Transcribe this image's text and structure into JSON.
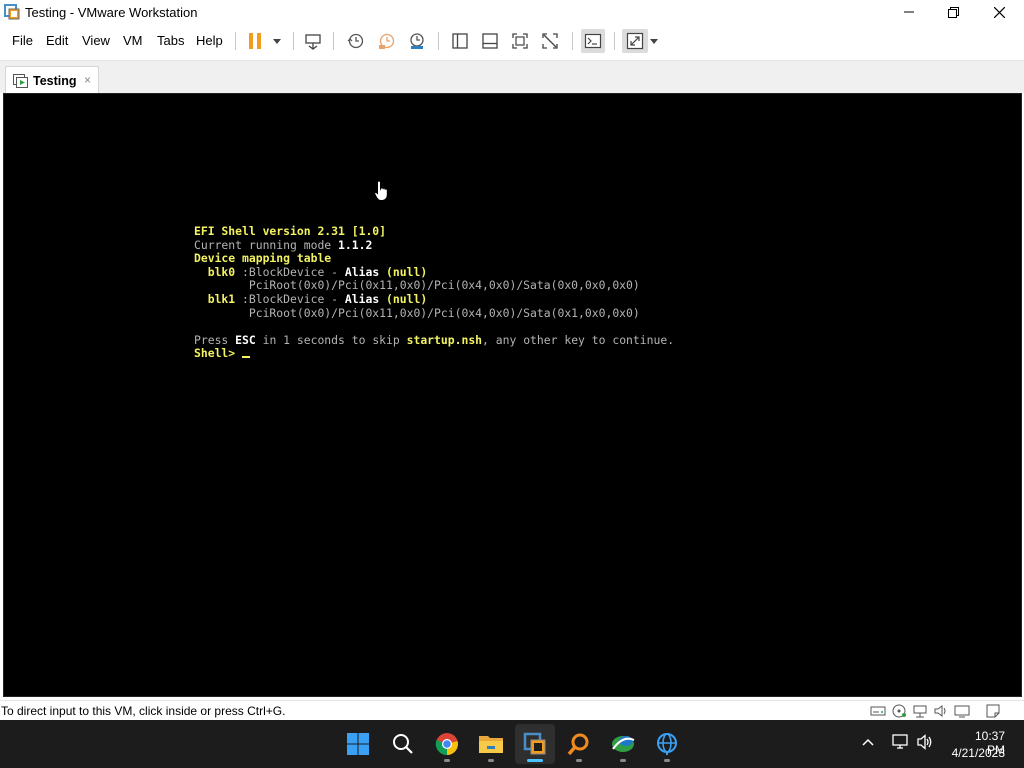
{
  "window": {
    "title": "Testing - VMware Workstation"
  },
  "menu": {
    "items": [
      "File",
      "Edit",
      "View",
      "VM",
      "Tabs",
      "Help"
    ]
  },
  "tab": {
    "label": "Testing",
    "close": "×"
  },
  "console": {
    "lines": [
      [
        {
          "t": "EFI Shell version 2.31 [1.0]",
          "c": "y"
        }
      ],
      [
        {
          "t": "Current running mode ",
          "c": "g"
        },
        {
          "t": "1.1.2",
          "c": "w"
        }
      ],
      [
        {
          "t": "Device mapping table",
          "c": "y"
        }
      ],
      [
        {
          "t": "  blk0",
          "c": "y"
        },
        {
          "t": " :BlockDevice - ",
          "c": "g"
        },
        {
          "t": "Alias",
          "c": "w"
        },
        {
          "t": " (null)",
          "c": "y"
        }
      ],
      [
        {
          "t": "        PciRoot(0x0)/Pci(0x11,0x0)/Pci(0x4,0x0)/Sata(0x0,0x0,0x0)",
          "c": "g"
        }
      ],
      [
        {
          "t": "  blk1",
          "c": "y"
        },
        {
          "t": " :BlockDevice - ",
          "c": "g"
        },
        {
          "t": "Alias",
          "c": "w"
        },
        {
          "t": " (null)",
          "c": "y"
        }
      ],
      [
        {
          "t": "        PciRoot(0x0)/Pci(0x11,0x0)/Pci(0x4,0x0)/Sata(0x1,0x0,0x0)",
          "c": "g"
        }
      ],
      [
        {
          "t": "",
          "c": "g"
        }
      ],
      [
        {
          "t": "Press ",
          "c": "g"
        },
        {
          "t": "ESC",
          "c": "w"
        },
        {
          "t": " in 1 seconds to skip ",
          "c": "g"
        },
        {
          "t": "startup.nsh",
          "c": "y"
        },
        {
          "t": ", any other key to continue.",
          "c": "g"
        }
      ],
      [
        {
          "t": "Shell> ",
          "c": "y"
        }
      ]
    ]
  },
  "status": {
    "text": "To direct input to this VM, click inside or press Ctrl+G."
  },
  "taskbar": {
    "apps": [
      "windows-start",
      "search",
      "chrome",
      "file-explorer",
      "vmware-workstation",
      "search-tool",
      "network-app",
      "globe-app"
    ],
    "active_app": "vmware-workstation",
    "time": "10:37 PM",
    "date": "4/21/2023"
  },
  "colors": {
    "efi_yellow": "#f2f262",
    "efi_gray": "#b4b4b4",
    "taskbar_bg": "#1c1c1c",
    "accent": "#4cc2ff"
  }
}
